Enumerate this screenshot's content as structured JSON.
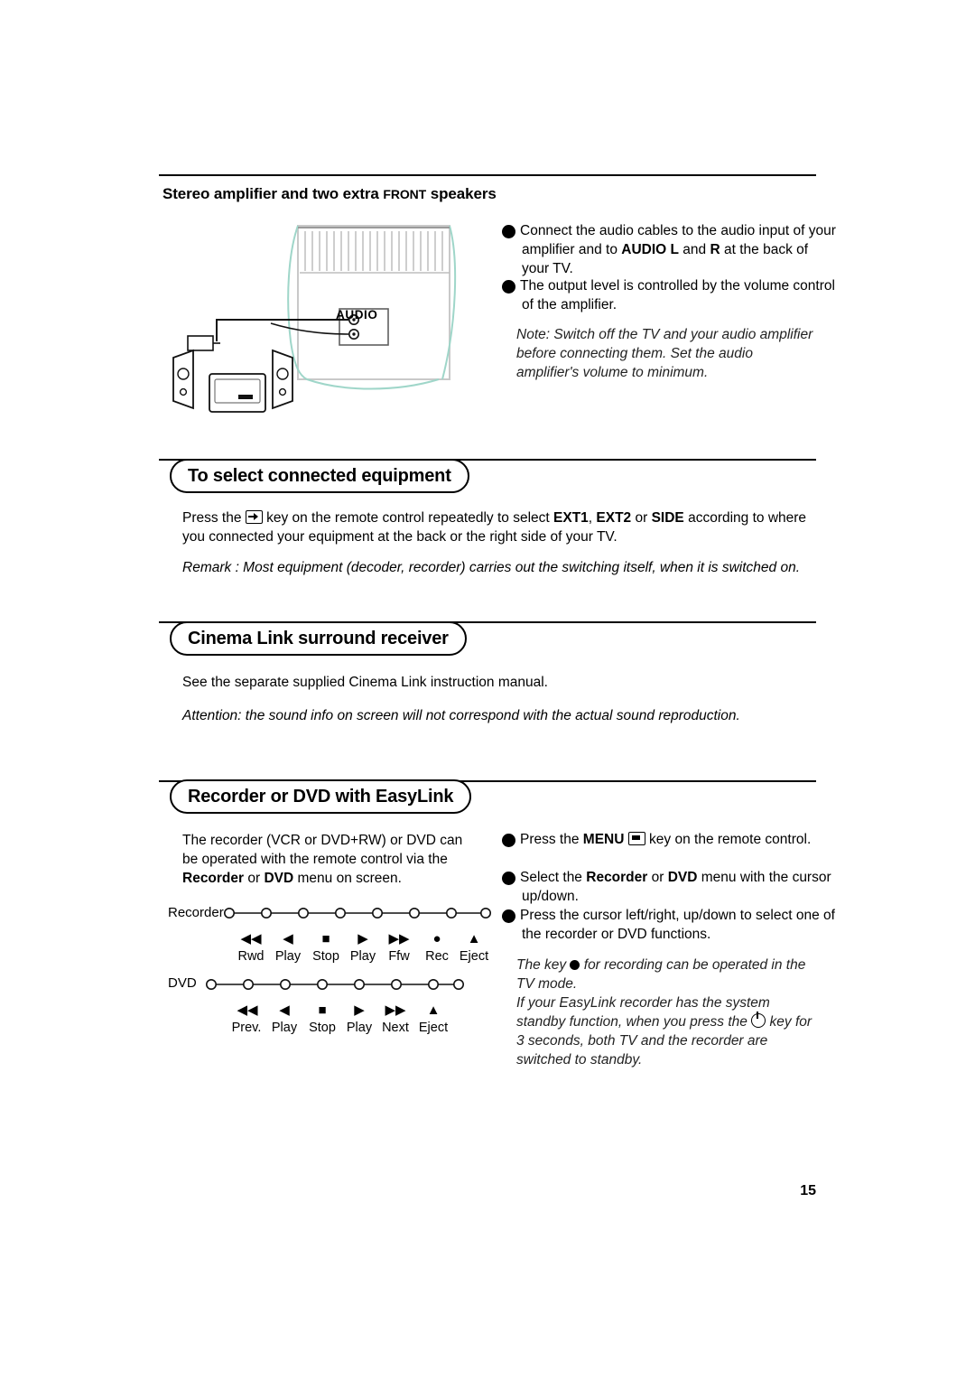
{
  "page": {
    "number": "15"
  },
  "section_amplifier": {
    "heading_pre": "Stereo amplifier and two extra ",
    "heading_caps": "FRONT",
    "heading_post": " speakers",
    "illustration": {
      "audio_label": "AUDIO",
      "name": "tv-back-audio-connection-illustration"
    },
    "steps": [
      {
        "num": "1",
        "parts": [
          {
            "text": "Connect the audio cables to the audio input of your amplifier and to "
          },
          {
            "text": "AUDIO L",
            "bold": true
          },
          {
            "text": " and "
          },
          {
            "text": "R",
            "bold": true
          },
          {
            "text": " at the back of your TV."
          }
        ]
      },
      {
        "num": "2",
        "parts": [
          {
            "text": "The output level is controlled by the volume control of the amplifier."
          }
        ]
      }
    ],
    "note": "Note: Switch off the TV and your audio amplifier before connecting them. Set the audio amplifier's volume to minimum."
  },
  "section_select": {
    "title": "To select connected equipment",
    "paragraph": [
      {
        "text": "Press the "
      },
      {
        "icon": "av-source-icon"
      },
      {
        "text": " key on the remote control repeatedly to select "
      },
      {
        "text": "EXT1",
        "bold": true
      },
      {
        "text": ", "
      },
      {
        "text": "EXT2",
        "bold": true
      },
      {
        "text": " or "
      },
      {
        "text": "SIDE",
        "bold": true
      },
      {
        "text": " according to where you connected your equipment at the back or the right side of your TV."
      }
    ],
    "remark": "Remark : Most equipment (decoder, recorder) carries out the switching itself, when it is switched on."
  },
  "section_cinema": {
    "title": "Cinema Link surround receiver",
    "paragraph": "See the separate supplied Cinema Link instruction manual.",
    "attention": "Attention: the sound info on screen will not correspond with the actual sound reproduction."
  },
  "section_recorder": {
    "title": "Recorder or DVD with EasyLink",
    "left_paragraph": [
      {
        "text": "The recorder (VCR or DVD+RW) or DVD can be operated with the remote control via the "
      },
      {
        "text": "Recorder",
        "bold": true
      },
      {
        "text": " or "
      },
      {
        "text": "DVD",
        "bold": true
      },
      {
        "text": " menu on screen."
      }
    ],
    "steps": [
      {
        "num": "1",
        "parts": [
          {
            "text": "Press the "
          },
          {
            "text": "MENU",
            "bold": true
          },
          {
            "text": " "
          },
          {
            "icon": "menu-key-icon"
          },
          {
            "text": " key on the remote control."
          }
        ]
      },
      {
        "num": "2",
        "parts": [
          {
            "text": "Select the "
          },
          {
            "text": "Recorder",
            "bold": true
          },
          {
            "text": " or "
          },
          {
            "text": "DVD",
            "bold": true
          },
          {
            "text": " menu with the cursor up/down."
          }
        ]
      },
      {
        "num": "3",
        "parts": [
          {
            "text": "Press the cursor left/right, up/down to select one of the recorder or DVD functions."
          }
        ]
      }
    ],
    "note1": [
      {
        "text": "The key "
      },
      {
        "icon": "record-dot-icon"
      },
      {
        "text": " for recording can be operated in the TV mode."
      }
    ],
    "note2": [
      {
        "text": "If your EasyLink recorder has the system standby function, when you press the "
      },
      {
        "icon": "standby-icon"
      },
      {
        "text": " key for 3 seconds, both TV and the recorder are switched to standby."
      }
    ],
    "chains": [
      {
        "label": "Recorder",
        "buttons": [
          {
            "glyph": "◀◀",
            "label": "Rwd"
          },
          {
            "glyph": "◀",
            "label": "Play"
          },
          {
            "glyph": "■",
            "label": "Stop"
          },
          {
            "glyph": "▶",
            "label": "Play"
          },
          {
            "glyph": "▶▶",
            "label": "Ffw"
          },
          {
            "glyph": "●",
            "label": "Rec"
          },
          {
            "glyph": "▲",
            "label": "Eject"
          }
        ]
      },
      {
        "label": "DVD",
        "buttons": [
          {
            "glyph": "◀◀",
            "label": "Prev."
          },
          {
            "glyph": "◀",
            "label": "Play"
          },
          {
            "glyph": "■",
            "label": "Stop"
          },
          {
            "glyph": "▶",
            "label": "Play"
          },
          {
            "glyph": "▶▶",
            "label": "Next"
          },
          {
            "glyph": "▲",
            "label": "Eject"
          }
        ]
      }
    ]
  }
}
